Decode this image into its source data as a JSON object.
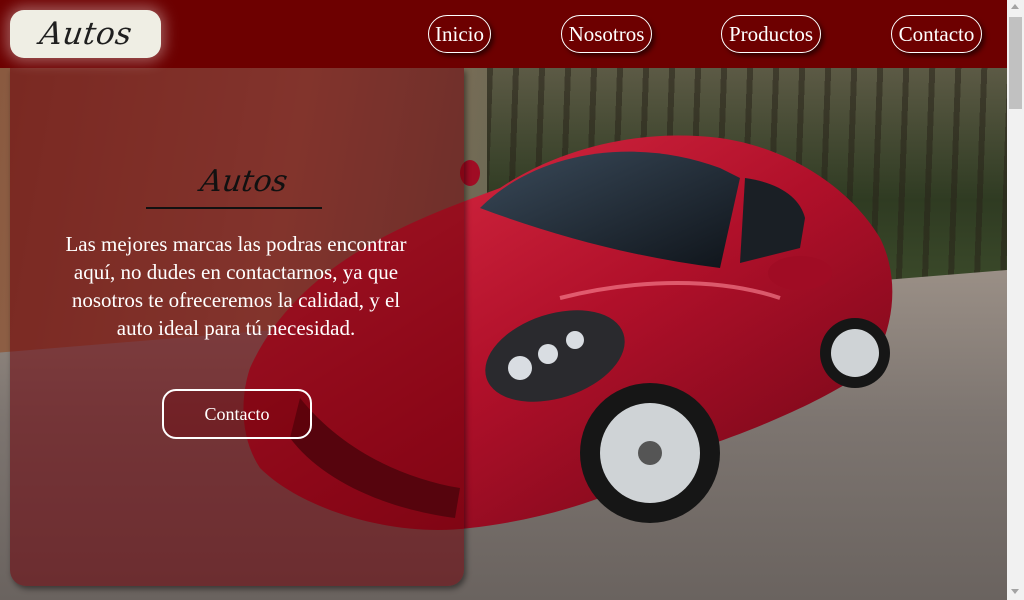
{
  "header": {
    "logo_text": "Autos",
    "nav": [
      {
        "label": "Inicio"
      },
      {
        "label": "Nosotros"
      },
      {
        "label": "Productos"
      },
      {
        "label": "Contacto"
      }
    ]
  },
  "hero": {
    "image": "red-sports-car-photo",
    "card": {
      "title": "Autos",
      "description": "Las mejores marcas las podras encontrar aquí, no dudes en contactarnos, ya que nosotros te ofreceremos la calidad, y el auto ideal para tú necesidad.",
      "button_label": "Contacto"
    }
  },
  "colors": {
    "header_bg": "#6d0000",
    "logo_bg": "#efeee4",
    "card_overlay": "rgba(110,0,10,0.55)"
  }
}
